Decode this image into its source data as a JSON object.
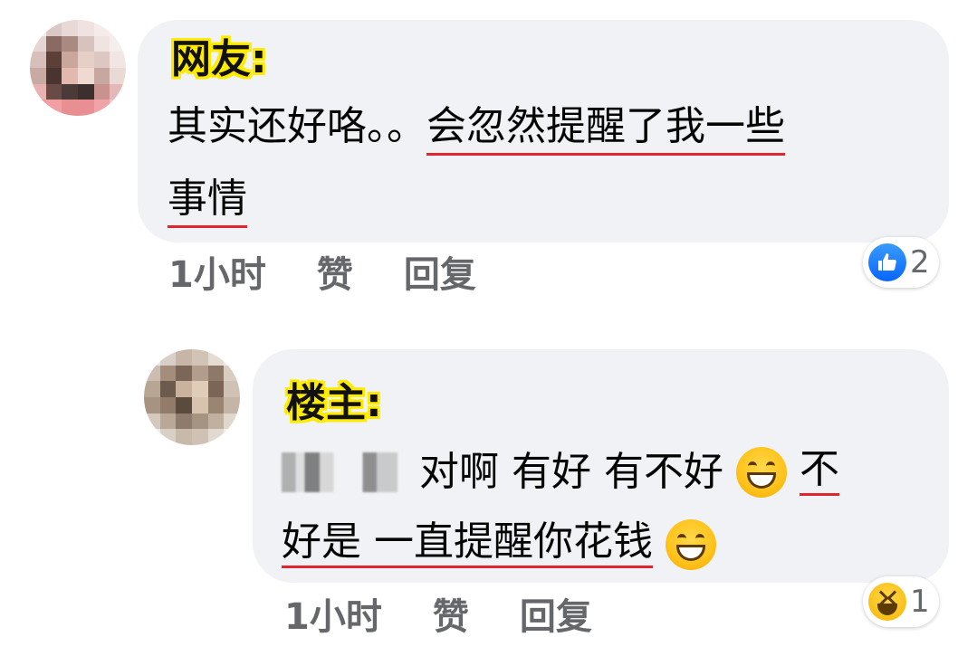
{
  "comments": [
    {
      "author": "网友:",
      "line1_plain": "其实还好咯。。",
      "line1_underlined": "会忽然提醒了我一些",
      "line2_underlined": "事情",
      "meta": {
        "time": "1小时",
        "like": "赞",
        "reply": "回复"
      },
      "reaction": {
        "icon": "like-icon",
        "count": "2",
        "color": "#0866ff"
      }
    },
    {
      "author": "楼主:",
      "line1_plain": "对啊 有好 有不好",
      "line1_underlined": "不",
      "line2_underlined": "好是 一直提醒你花钱",
      "emoji": "grinning-face-icon",
      "meta": {
        "time": "1小时",
        "like": "赞",
        "reply": "回复"
      },
      "reaction": {
        "icon": "haha-icon",
        "count": "1",
        "color": "#f7b500"
      }
    }
  ],
  "colors": {
    "bubble": "#f0f2f5",
    "underline": "#e0252f",
    "author_highlight": "#ffeb00",
    "meta_text": "#65676b"
  }
}
